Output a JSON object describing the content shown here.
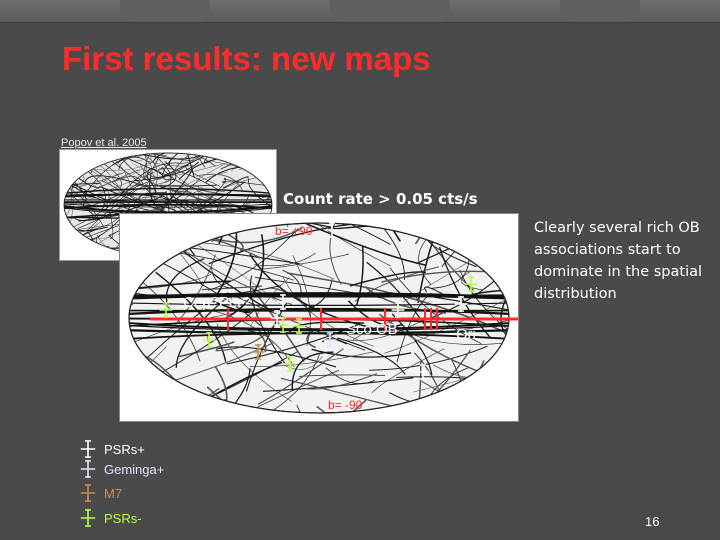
{
  "slide": {
    "title": "First results: new maps",
    "citation": "Popov et al. 2005",
    "count_rate_label": "Count rate > 0.05 cts/s",
    "side_text": "Clearly several rich OB associations start to dominate in the spatial distribution",
    "page_number": "16"
  },
  "map": {
    "top_label": "b= +90",
    "bottom_label": "b= -90",
    "regions": {
      "cep_per": "Cep?Per?",
      "sco_ob": "Sco OB",
      "ori": "Ori"
    }
  },
  "legend": [
    {
      "label": "PSRs+",
      "color": "#ffffff",
      "icon": "white-star-icon"
    },
    {
      "label": "Geminga+",
      "color": "#dce8ff",
      "icon": "blue-star-icon"
    },
    {
      "label": "M7",
      "color": "#d28a4a",
      "icon": "orange-star-icon"
    },
    {
      "label": "PSRs-",
      "color": "#b4ff4a",
      "icon": "green-star-icon"
    }
  ],
  "colors": {
    "title": "#ff2a2a",
    "galactic_plane": "#ff2a2a",
    "background": "#4a4a4a"
  }
}
